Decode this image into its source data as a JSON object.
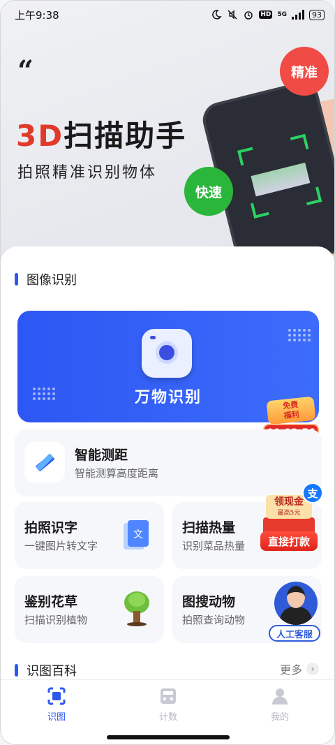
{
  "status_bar": {
    "time": "上午9:38",
    "network": "5G",
    "battery": "93",
    "hd": "HD"
  },
  "banner": {
    "quote_mark": "“",
    "title_accent": "3D",
    "title_rest": "扫描助手",
    "subtitle": "拍照精准识别物体",
    "badge_accurate": "精准",
    "badge_fast": "快速",
    "colors": {
      "accent_red": "#e23a2a",
      "badge_red": "#f04c45",
      "badge_green": "#2ab63a"
    }
  },
  "image_section": {
    "title": "图像识别"
  },
  "hero_card": {
    "label": "万物识别",
    "icon": "camera-icon",
    "color": "#2d57f3"
  },
  "reward_timer": {
    "gift_text_line1": "免费",
    "gift_text_line2": "福利",
    "countdown": "00:02:56"
  },
  "features": {
    "distance": {
      "title": "智能测距",
      "subtitle": "智能测算高度距离",
      "icon": "ruler-pencil-icon"
    },
    "text": {
      "title": "拍照识字",
      "subtitle": "一键图片转文字",
      "icon": "document-text-icon"
    },
    "calorie": {
      "title": "扫描热量",
      "subtitle": "识别菜品热量",
      "icon": "food-scan-icon"
    },
    "plant": {
      "title": "鉴别花草",
      "subtitle": "扫描识别植物",
      "icon": "tree-icon"
    },
    "animal": {
      "title": "图搜动物",
      "subtitle": "拍照查询动物",
      "icon": "animal-search-icon"
    }
  },
  "cash_promo": {
    "title": "领现金",
    "subtitle": "最高5元",
    "button": "直接打款",
    "alipay_mark": "支"
  },
  "customer_service": {
    "label": "人工客服"
  },
  "encyclopedia": {
    "title": "识图百科",
    "more": "更多",
    "chevron": "›"
  },
  "tabbar": {
    "tabs": [
      {
        "label": "识图",
        "icon": "scan-icon",
        "active": true
      },
      {
        "label": "计数",
        "icon": "counter-icon",
        "active": false
      },
      {
        "label": "我的",
        "icon": "profile-icon",
        "active": false
      }
    ],
    "active_color": "#2b59f0"
  }
}
